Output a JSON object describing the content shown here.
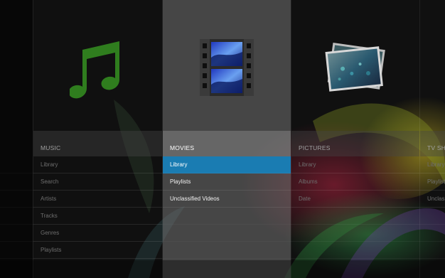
{
  "menu": [
    {
      "title": "MUSIC",
      "icon": "music-note-icon",
      "items": [
        "Library",
        "Search",
        "Artists",
        "Tracks",
        "Genres",
        "Playlists"
      ]
    },
    {
      "title": "MOVIES",
      "icon": "film-strip-icon",
      "selected_item": "Library",
      "items": [
        "Library",
        "Playlists",
        "Unclassified Videos"
      ]
    },
    {
      "title": "PICTURES",
      "icon": "photo-stack-icon",
      "items": [
        "Library",
        "Albums",
        "Date"
      ]
    },
    {
      "title": "TV SHOWS",
      "icon": "tv-icon",
      "items": [
        "Library",
        "Playlists",
        "Unclassified"
      ]
    }
  ],
  "colors": {
    "accent": "#1a7cb2",
    "music_icon": "#2f7d1e",
    "background": "#0b0b0b"
  }
}
